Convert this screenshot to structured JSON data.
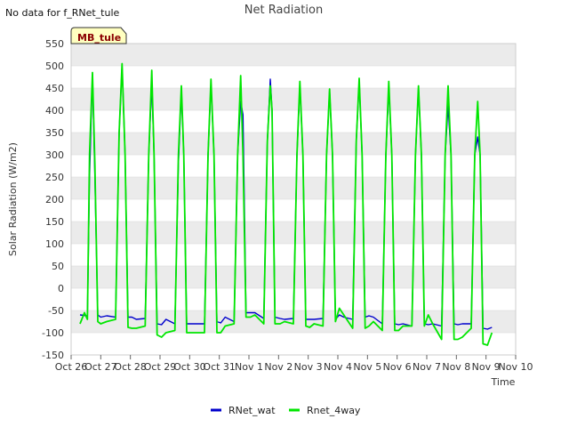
{
  "notice": "No data for f_RNet_tule",
  "badge": "MB_tule",
  "colors": {
    "RNet_wat": "#0000cc",
    "Rnet_4way": "#00e600",
    "band": "#ebebeb",
    "grid": "#d8d8d8"
  },
  "chart_data": {
    "type": "line",
    "title": "Net Radiation",
    "xlabel": "Time",
    "ylabel": "Solar Radiation (W/m2)",
    "ylim": [
      -150,
      550
    ],
    "xlim": [
      0,
      15
    ],
    "yticks": [
      -150,
      -100,
      -50,
      0,
      50,
      100,
      150,
      200,
      250,
      300,
      350,
      400,
      450,
      500,
      550
    ],
    "xtick_labels": [
      "Oct 26",
      "Oct 27",
      "Oct 28",
      "Oct 29",
      "Oct 30",
      "Oct 31",
      "Nov 1",
      "Nov 2",
      "Nov 3",
      "Nov 4",
      "Nov 5",
      "Nov 6",
      "Nov 7",
      "Nov 8",
      "Nov 9",
      "Nov 10"
    ],
    "grid": true,
    "legend": "bottom-center",
    "series": [
      {
        "name": "RNet_wat",
        "x": [
          0.3,
          0.55,
          0.62,
          0.72,
          0.8,
          0.9,
          1.0,
          1.2,
          1.5,
          1.62,
          1.72,
          1.82,
          1.92,
          2.05,
          2.2,
          2.5,
          2.62,
          2.72,
          2.8,
          2.9,
          3.05,
          3.2,
          3.5,
          3.62,
          3.72,
          3.8,
          3.9,
          4.05,
          4.2,
          4.5,
          4.62,
          4.72,
          4.82,
          4.92,
          5.05,
          5.2,
          5.5,
          5.62,
          5.72,
          5.8,
          5.9,
          6.05,
          6.2,
          6.5,
          6.62,
          6.72,
          6.78,
          6.88,
          7.05,
          7.2,
          7.5,
          7.62,
          7.72,
          7.82,
          7.92,
          8.05,
          8.2,
          8.5,
          8.62,
          8.72,
          8.82,
          8.92,
          9.05,
          9.2,
          9.5,
          9.62,
          9.72,
          9.82,
          9.92,
          10.05,
          10.2,
          10.5,
          10.62,
          10.72,
          10.82,
          10.92,
          11.05,
          11.2,
          11.5,
          11.62,
          11.72,
          11.82,
          11.92,
          12.05,
          12.2,
          12.5,
          12.62,
          12.72,
          12.82,
          12.92,
          13.05,
          13.2,
          13.5,
          13.62,
          13.72,
          13.8,
          13.9,
          14.05,
          14.2
        ],
        "y": [
          -60,
          -62,
          250,
          480,
          250,
          -60,
          -65,
          -62,
          -65,
          350,
          500,
          300,
          -65,
          -65,
          -70,
          -68,
          300,
          460,
          300,
          -80,
          -82,
          -70,
          -80,
          280,
          445,
          300,
          -80,
          -80,
          -80,
          -80,
          300,
          460,
          300,
          -75,
          -78,
          -65,
          -75,
          300,
          420,
          390,
          -55,
          -55,
          -55,
          -68,
          330,
          470,
          400,
          -65,
          -68,
          -70,
          -68,
          300,
          455,
          300,
          -70,
          -70,
          -70,
          -68,
          300,
          445,
          300,
          -70,
          -60,
          -65,
          -70,
          330,
          465,
          300,
          -65,
          -62,
          -65,
          -80,
          300,
          450,
          300,
          -80,
          -82,
          -80,
          -85,
          300,
          450,
          300,
          -80,
          -82,
          -80,
          -85,
          300,
          410,
          300,
          -80,
          -82,
          -80,
          -80,
          300,
          340,
          300,
          -90,
          -92,
          -88
        ]
      },
      {
        "name": "Rnet_4way",
        "x": [
          0.3,
          0.45,
          0.55,
          0.62,
          0.72,
          0.8,
          0.9,
          1.0,
          1.2,
          1.5,
          1.62,
          1.72,
          1.82,
          1.92,
          2.05,
          2.2,
          2.5,
          2.62,
          2.72,
          2.8,
          2.9,
          3.05,
          3.2,
          3.5,
          3.62,
          3.72,
          3.8,
          3.9,
          4.05,
          4.2,
          4.5,
          4.62,
          4.72,
          4.82,
          4.92,
          5.05,
          5.2,
          5.5,
          5.62,
          5.72,
          5.8,
          5.9,
          6.05,
          6.2,
          6.5,
          6.62,
          6.72,
          6.78,
          6.88,
          7.05,
          7.2,
          7.5,
          7.62,
          7.72,
          7.82,
          7.92,
          8.05,
          8.2,
          8.5,
          8.62,
          8.72,
          8.82,
          8.92,
          9.05,
          9.2,
          9.5,
          9.62,
          9.72,
          9.82,
          9.92,
          10.05,
          10.2,
          10.5,
          10.62,
          10.72,
          10.82,
          10.92,
          11.05,
          11.2,
          11.5,
          11.62,
          11.72,
          11.82,
          11.92,
          12.05,
          12.2,
          12.5,
          12.62,
          12.72,
          12.82,
          12.92,
          13.05,
          13.2,
          13.5,
          13.62,
          13.72,
          13.8,
          13.9,
          14.05,
          14.2
        ],
        "y": [
          -80,
          -55,
          -70,
          300,
          485,
          280,
          -75,
          -80,
          -75,
          -70,
          350,
          505,
          300,
          -88,
          -90,
          -90,
          -85,
          300,
          490,
          300,
          -105,
          -110,
          -100,
          -95,
          300,
          455,
          300,
          -100,
          -100,
          -100,
          -100,
          300,
          470,
          300,
          -100,
          -100,
          -85,
          -80,
          300,
          478,
          300,
          -65,
          -65,
          -60,
          -80,
          330,
          455,
          400,
          -80,
          -80,
          -75,
          -80,
          300,
          465,
          300,
          -85,
          -88,
          -80,
          -85,
          300,
          448,
          300,
          -75,
          -45,
          -60,
          -90,
          330,
          472,
          300,
          -90,
          -85,
          -75,
          -95,
          300,
          465,
          300,
          -95,
          -95,
          -85,
          -85,
          300,
          455,
          300,
          -85,
          -60,
          -80,
          -115,
          300,
          455,
          300,
          -115,
          -115,
          -110,
          -90,
          300,
          420,
          300,
          -125,
          -128,
          -100
        ]
      }
    ]
  }
}
